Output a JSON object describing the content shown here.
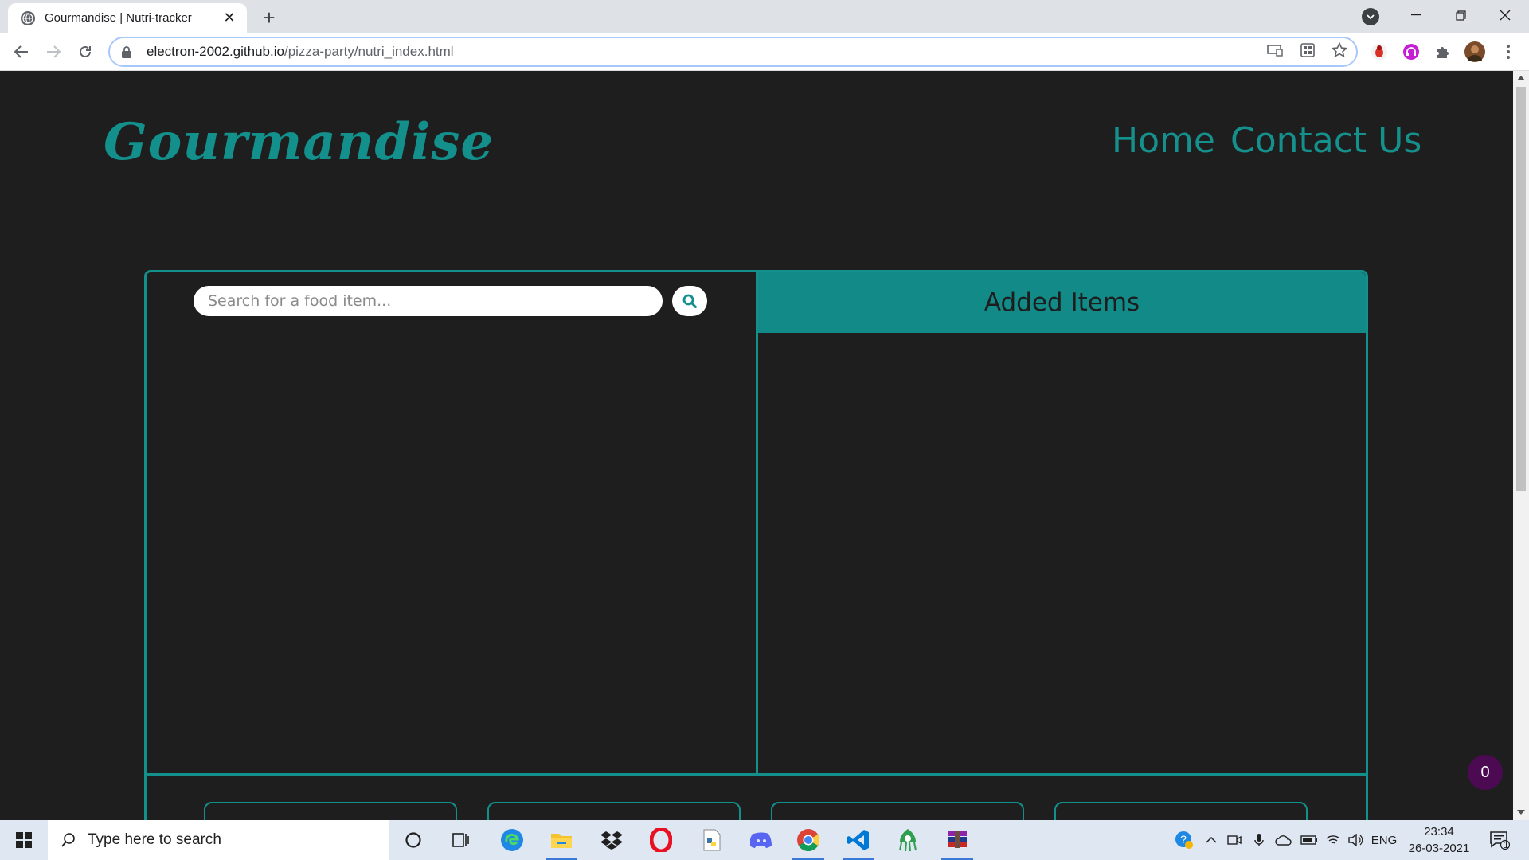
{
  "browser": {
    "tab_title": "Gourmandise | Nutri-tracker",
    "url_domain": "electron-2002.github.io",
    "url_path": "/pizza-party/nutri_index.html"
  },
  "site": {
    "logo": "Gourmandise",
    "nav": {
      "home": "Home",
      "contact": "Contact Us"
    }
  },
  "search": {
    "placeholder": "Search for a food item..."
  },
  "added_items": {
    "title": "Added Items"
  },
  "badge": {
    "count": "0"
  },
  "taskbar": {
    "search_placeholder": "Type here to search",
    "language": "ENG",
    "time": "23:34",
    "date": "26-03-2021",
    "notifications": "1"
  },
  "colors": {
    "accent": "#138f8c",
    "page_bg": "#1f1e1e",
    "badge": "#4b0a52"
  }
}
